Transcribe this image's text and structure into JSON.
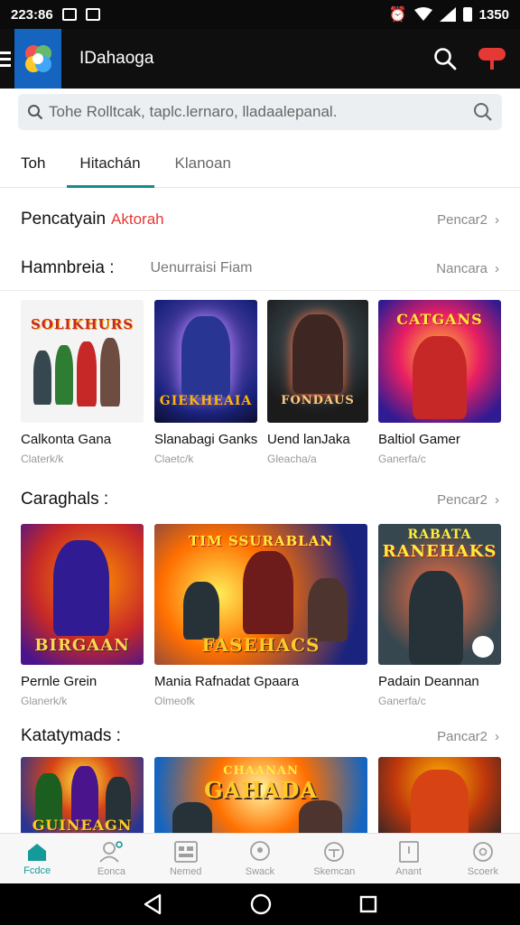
{
  "status_bar": {
    "time": "223:86",
    "clock": "1350"
  },
  "app_bar": {
    "title": "IDahaoga"
  },
  "search": {
    "placeholder": "Tohe Rolltcak, taplc.lernaro, lladaalepanal."
  },
  "tabs": [
    {
      "label": "Toh"
    },
    {
      "label": "Hitachán"
    },
    {
      "label": "Klanoan"
    }
  ],
  "sections": [
    {
      "title": "Pencatyain",
      "accent": "Aktorah",
      "more": "Pencar2"
    },
    {
      "title": "Hamnbreia :",
      "subtitle": "Uenurraisi Fiam",
      "more": "Nancara"
    },
    {
      "title": "Caraghals :",
      "more": "Pencar2"
    },
    {
      "title": "Katatymads :",
      "more": "Pancar2"
    }
  ],
  "row1_cards": [
    {
      "name": "Calkonta Gana",
      "meta": "Claterk/k",
      "art_title": "SOLIKHURS"
    },
    {
      "name": "Slanabagi Ganks",
      "meta": "Claetc/k",
      "art_title": "GIEKHEAIA"
    },
    {
      "name": "Uend lanJaka",
      "meta": "Gleacha/a",
      "art_title": "FONDAUS"
    },
    {
      "name": "Baltiol Gamer",
      "meta": "Ganerfa/c",
      "art_title": "CATGANS"
    }
  ],
  "row2_cards": [
    {
      "name": "Pernle Grein",
      "meta": "Glanerk/k",
      "art_title": "BIRGAAN"
    },
    {
      "name": "Mania Rafnadat Gpaara",
      "meta": "Olmeofk",
      "art_title": "FASEHACS",
      "art_top": "TIM SSURABLAN"
    },
    {
      "name": "Padain Deannan",
      "meta": "Ganerfa/c",
      "art_title": "RANEHAKS",
      "art_top": "RABATA"
    }
  ],
  "row3_cards": [
    {
      "art_title": "GUINEAGN"
    },
    {
      "art_title": "GAHADA",
      "art_top": "CHAANAN"
    },
    {
      "art_title": ""
    }
  ],
  "bottom_nav": [
    {
      "label": "Fcdce"
    },
    {
      "label": "Eonca"
    },
    {
      "label": "Nemed"
    },
    {
      "label": "Swack"
    },
    {
      "label": "Skemcan"
    },
    {
      "label": "Anant"
    },
    {
      "label": "Scoerk"
    }
  ],
  "colors": {
    "accent": "#159a9a",
    "notify": "#e53935",
    "logo_bg": "#1565c0"
  }
}
